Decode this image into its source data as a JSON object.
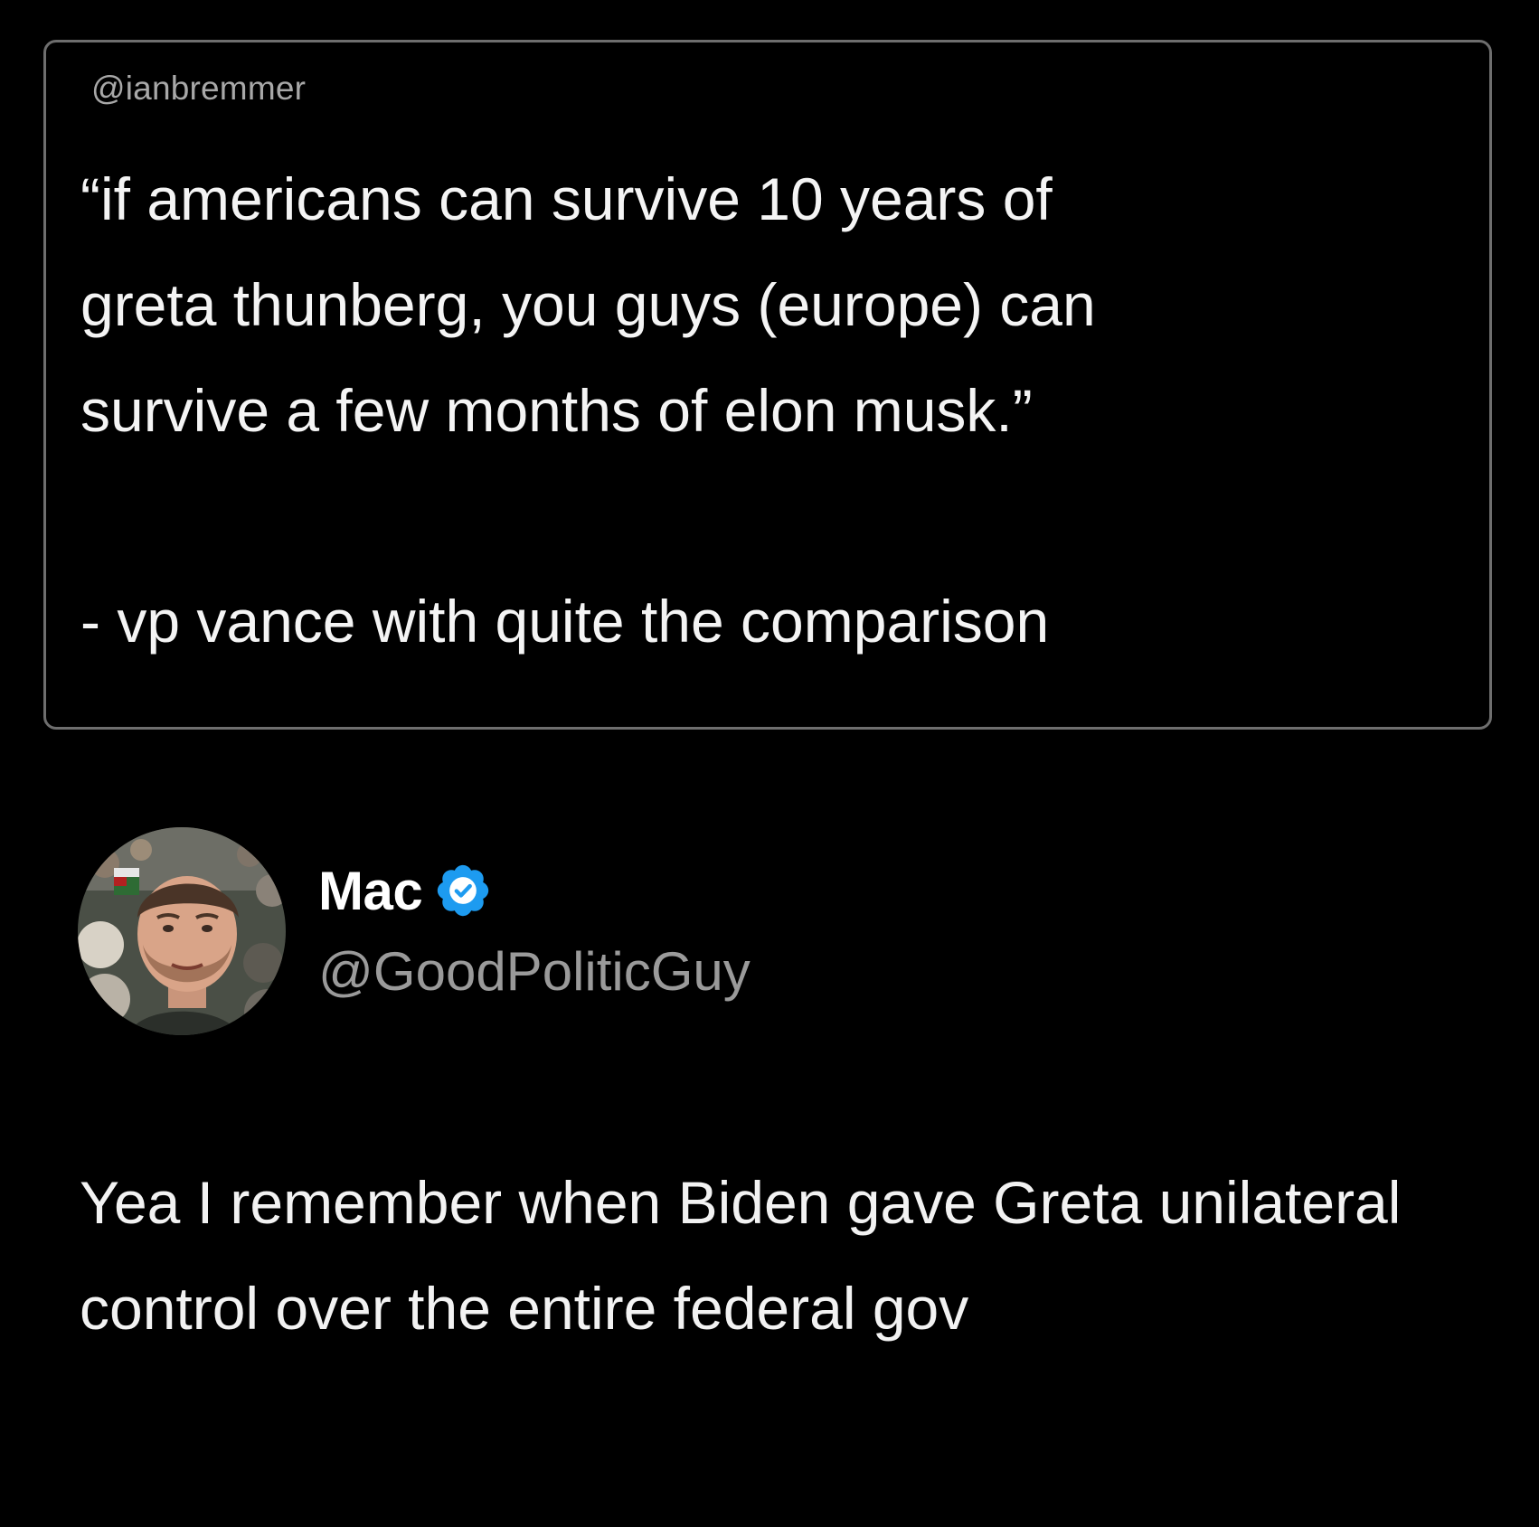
{
  "quoted_post": {
    "handle": "@ianbremmer",
    "text": "“if americans can survive 10 years of\ngreta thunberg, you guys (europe) can\nsurvive a few months of elon musk.”",
    "attribution": "- vp vance with quite the comparison"
  },
  "reply_post": {
    "display_name": "Mac",
    "handle": "@GoodPoliticGuy",
    "verified_icon": "verified-badge-icon",
    "text": "Yea I remember when Biden gave Greta unilateral control over the entire federal gov"
  },
  "colors": {
    "background": "#000000",
    "quote_border": "#6e6e6e",
    "primary_text": "#f2f2f2",
    "secondary_text": "#9a9a9a",
    "verified_blue": "#1d9bf0"
  }
}
